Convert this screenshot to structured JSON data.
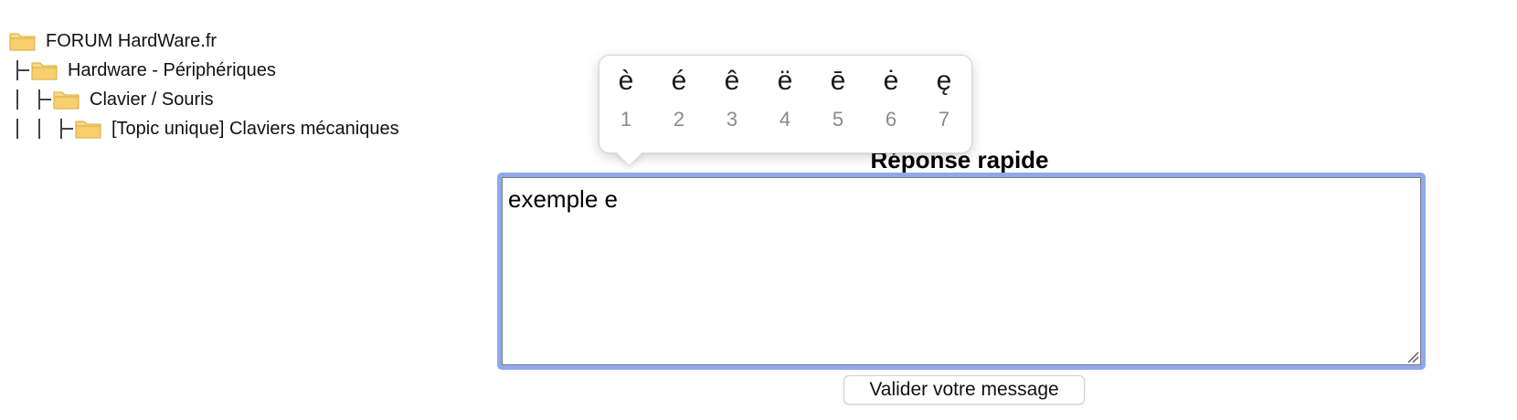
{
  "breadcrumb": {
    "items": [
      {
        "label": "FORUM HardWare.fr",
        "icon": "folder-icon"
      },
      {
        "label": "Hardware - Périphériques",
        "icon": "folder-icon"
      },
      {
        "label": "Clavier / Souris",
        "icon": "folder-icon"
      },
      {
        "label": "[Topic unique] Claviers mécaniques",
        "icon": "folder-icon"
      }
    ]
  },
  "accent_popup": {
    "options": [
      {
        "char": "è",
        "key": "1"
      },
      {
        "char": "é",
        "key": "2"
      },
      {
        "char": "ê",
        "key": "3"
      },
      {
        "char": "ë",
        "key": "4"
      },
      {
        "char": "ē",
        "key": "5"
      },
      {
        "char": "ė",
        "key": "6"
      },
      {
        "char": "ę",
        "key": "7"
      }
    ]
  },
  "quick_reply": {
    "title": "Réponse rapide",
    "text": "exemple e",
    "submit_label": "Valider votre message"
  },
  "colors": {
    "focus_ring": "#8fa9ec",
    "folder": "#f2c866"
  }
}
